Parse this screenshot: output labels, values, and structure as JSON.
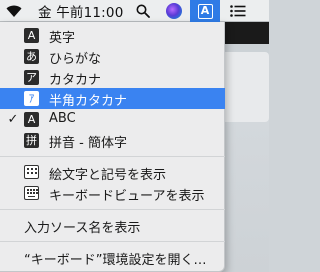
{
  "menubar": {
    "clock": "金 午前11:00",
    "ime_letter": "A"
  },
  "menu": {
    "input_sources": [
      {
        "badge": "A",
        "label": "英字",
        "checked": false,
        "selected": false
      },
      {
        "badge": "あ",
        "label": "ひらがな",
        "checked": false,
        "selected": false
      },
      {
        "badge": "ア",
        "label": "カタカナ",
        "checked": false,
        "selected": false
      },
      {
        "badge": "ｱ",
        "label": "半角カタカナ",
        "checked": false,
        "selected": true
      },
      {
        "badge": "A",
        "label": "ABC",
        "checked": true,
        "selected": false
      },
      {
        "badge": "拼",
        "label": "拼音 - 簡体字",
        "checked": false,
        "selected": false
      }
    ],
    "checkmark": "✓",
    "show_emoji": "絵文字と記号を表示",
    "show_keyboard_viewer": "キーボードビューアを表示",
    "show_input_source_name": "入力ソース名を表示",
    "open_keyboard_prefs": "“キーボード”環境設定を開く…"
  }
}
